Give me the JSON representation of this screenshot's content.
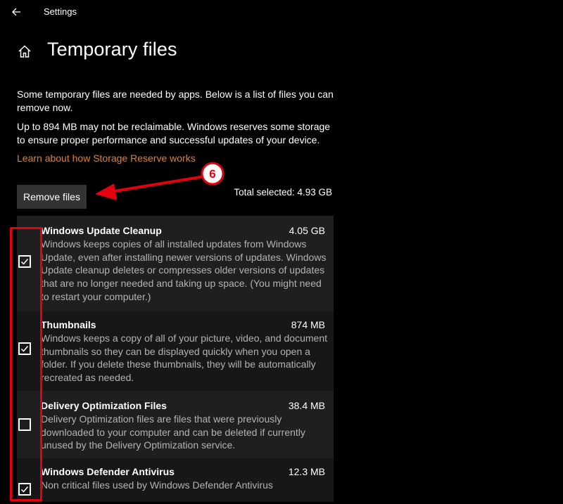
{
  "window": {
    "app_title": "Settings"
  },
  "page": {
    "title": "Temporary files",
    "description_1": "Some temporary files are needed by apps. Below is a list of files you can remove now.",
    "description_2": "Up to 894 MB may not be reclaimable. Windows reserves some storage to ensure proper performance and successful updates of your device.",
    "link_text": "Learn about how Storage Reserve works",
    "remove_button_label": "Remove files",
    "total_selected": "Total selected: 4.93 GB"
  },
  "items": [
    {
      "name": "Windows Update Cleanup",
      "size": "4.05 GB",
      "checked": true,
      "description": "Windows keeps copies of all installed updates from Windows Update, even after installing newer versions of updates. Windows Update cleanup deletes or compresses older versions of updates that are no longer needed and taking up space. (You might need to restart your computer.)"
    },
    {
      "name": "Thumbnails",
      "size": "874 MB",
      "checked": true,
      "description": "Windows keeps a copy of all of your picture, video, and document thumbnails so they can be displayed quickly when you open a folder. If you delete these thumbnails, they will be automatically recreated as needed."
    },
    {
      "name": "Delivery Optimization Files",
      "size": "38.4 MB",
      "checked": false,
      "description": "Delivery Optimization files are files that were previously downloaded to your computer and can be deleted if currently unused by the Delivery Optimization service."
    },
    {
      "name": "Windows Defender Antivirus",
      "size": "12.3 MB",
      "checked": true,
      "description": "Non critical files used by Windows Defender Antivirus"
    }
  ],
  "annotation": {
    "step_number": "6",
    "color": "#e3000f"
  },
  "colors": {
    "accent_link": "#e2812a",
    "button_bg": "#333333",
    "background": "#000000"
  },
  "icons": {
    "back": "arrow-left-icon",
    "home": "home-icon",
    "check": "checkmark-icon"
  }
}
